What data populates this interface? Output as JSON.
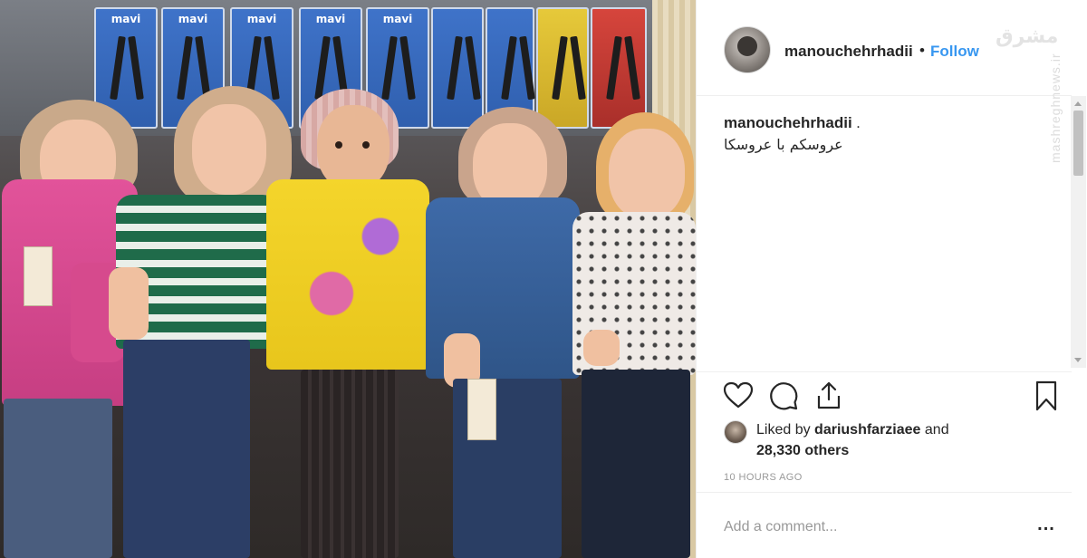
{
  "post": {
    "username": "manouchehrhadii",
    "separator": "•",
    "follow_label": "Follow",
    "caption": {
      "username": "manouchehrhadii",
      "dot": ".",
      "text": "عروسکم با عروسکا"
    },
    "likes": {
      "prefix": "Liked by",
      "liker": "dariushfarziaee",
      "and": "and",
      "count": "28,330 others"
    },
    "timestamp": "10 HOURS AGO",
    "comment": {
      "placeholder": "Add a comment...",
      "more_label": "..."
    }
  },
  "photo": {
    "package_brand": "mavi"
  },
  "watermark": {
    "logo": "مشرق",
    "side": "mashreghnews.ir"
  },
  "icons": {
    "like": "heart-icon",
    "comment": "comment-icon",
    "share": "share-icon",
    "save": "bookmark-icon"
  },
  "colors": {
    "follow": "#3897f0",
    "text": "#262626",
    "muted": "#999999",
    "divider": "#efefef"
  }
}
